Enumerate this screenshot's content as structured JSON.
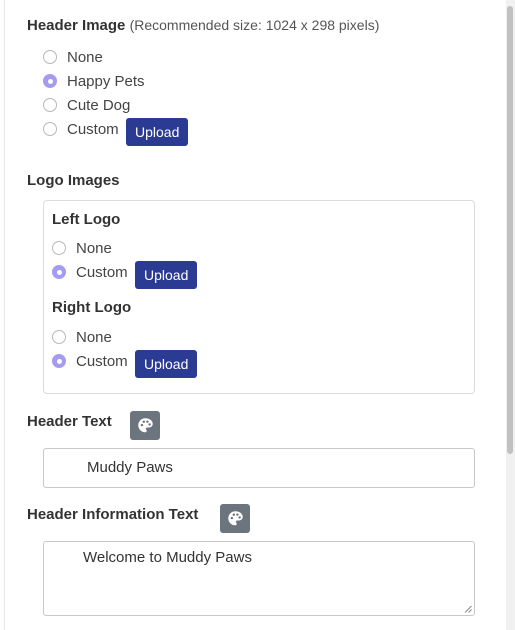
{
  "header_image": {
    "title": "Header Image",
    "hint": "(Recommended size: 1024 x 298 pixels)",
    "options": [
      {
        "label": "None",
        "checked": false
      },
      {
        "label": "Happy Pets",
        "checked": true
      },
      {
        "label": "Cute Dog",
        "checked": false
      },
      {
        "label": "Custom",
        "checked": false
      }
    ],
    "upload_label": "Upload"
  },
  "logo_images": {
    "title": "Logo Images",
    "left_logo": {
      "title": "Left Logo",
      "options": [
        {
          "label": "None",
          "checked": false
        },
        {
          "label": "Custom",
          "checked": true
        }
      ],
      "upload_label": "Upload"
    },
    "right_logo": {
      "title": "Right Logo",
      "options": [
        {
          "label": "None",
          "checked": false
        },
        {
          "label": "Custom",
          "checked": true
        }
      ],
      "upload_label": "Upload"
    }
  },
  "header_text": {
    "title": "Header Text",
    "value": "Muddy Paws",
    "icon": "palette-icon"
  },
  "header_info_text": {
    "title": "Header Information Text",
    "value": "Welcome to Muddy Paws",
    "icon": "palette-icon"
  },
  "colors": {
    "accent_radio": "#a59cf0",
    "upload_button": "#2b3a93",
    "palette_button": "#6c757d"
  }
}
